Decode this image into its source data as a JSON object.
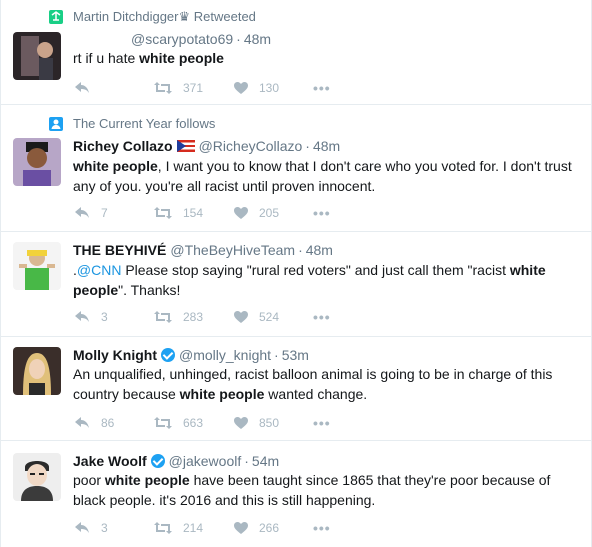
{
  "tweets": [
    {
      "context": "Martin Ditchdigger♛ Retweeted",
      "fullname": "",
      "handle": "@scarypotato69",
      "time": "48m",
      "text_parts": [
        "rt if u hate ",
        "white people"
      ],
      "reply_count": "",
      "retweet_count": "371",
      "like_count": "130"
    },
    {
      "context": "The Current Year follows",
      "fullname": "Richey Collazo",
      "handle": "@RicheyCollazo",
      "time": "48m",
      "text_parts": [
        "white people",
        ", I want you to know that I don't care who you voted for. I don't trust any of you. you're all racist until proven innocent."
      ],
      "reply_count": "7",
      "retweet_count": "154",
      "like_count": "205"
    },
    {
      "context": "",
      "fullname": "THE BEYHIVÉ",
      "handle": "@TheBeyHiveTeam",
      "time": "48m",
      "text_parts": [
        ".",
        "@CNN",
        " Please stop saying \"rural red voters\" and just call them \"racist ",
        "white people",
        "\".  Thanks!"
      ],
      "reply_count": "3",
      "retweet_count": "283",
      "like_count": "524"
    },
    {
      "context": "",
      "fullname": "Molly Knight",
      "handle": "@molly_knight",
      "time": "53m",
      "text_parts": [
        "An unqualified, unhinged, racist balloon animal is going to be in charge of this country because ",
        "white people",
        " wanted change."
      ],
      "reply_count": "86",
      "retweet_count": "663",
      "like_count": "850"
    },
    {
      "context": "",
      "fullname": "Jake Woolf",
      "handle": "@jakewoolf",
      "time": "54m",
      "text_parts": [
        "poor ",
        "white people",
        " have been taught since 1865 that they're poor because of black people. it's 2016 and this is still happening."
      ],
      "reply_count": "3",
      "retweet_count": "214",
      "like_count": "266"
    }
  ],
  "dot": "·",
  "more_label": "•••",
  "colors": {
    "retweet_icon": "#19cf86",
    "follow_icon": "#1da1f2",
    "action_gray": "#aab8c2",
    "meta_gray": "#657786",
    "link_blue": "#1b95e0"
  }
}
